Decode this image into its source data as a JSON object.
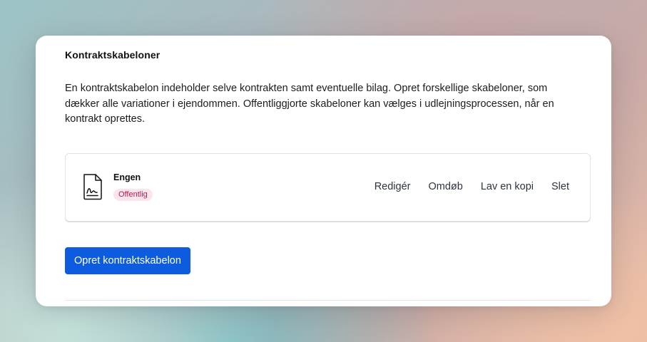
{
  "section": {
    "title": "Kontraktskabeloner",
    "description": "En kontraktskabelon indeholder selve kontrakten samt eventuelle bilag. Opret forskellige skabeloner, som dækker alle variationer i ejendommen. Offentliggjorte skabeloner kan vælges i udlejningsprocessen, når en kontrakt oprettes."
  },
  "templates": [
    {
      "icon": "contract-document-icon",
      "name": "Engen",
      "status": "Offentlig",
      "actions": [
        "Redigér",
        "Omdøb",
        "Lav en kopi",
        "Slet"
      ]
    }
  ],
  "create_button_label": "Opret kontraktskabelon",
  "colors": {
    "primary": "#0d5ce0",
    "badge_text": "#b2234f",
    "badge_bg": "#fbe4ec"
  }
}
